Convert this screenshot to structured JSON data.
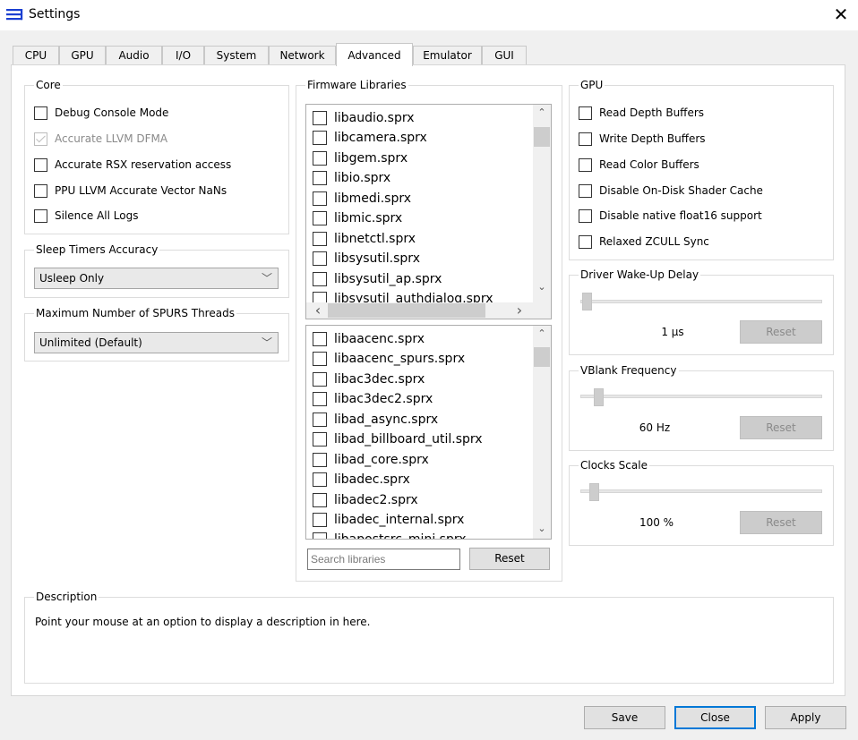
{
  "window": {
    "title": "Settings",
    "close_glyph": "✕"
  },
  "tabs": [
    {
      "label": "CPU"
    },
    {
      "label": "GPU"
    },
    {
      "label": "Audio"
    },
    {
      "label": "I/O"
    },
    {
      "label": "System"
    },
    {
      "label": "Network"
    },
    {
      "label": "Advanced"
    },
    {
      "label": "Emulator"
    },
    {
      "label": "GUI"
    }
  ],
  "active_tab": "Advanced",
  "core": {
    "title": "Core",
    "options": [
      {
        "label": "Debug Console Mode",
        "checked": false,
        "enabled": true
      },
      {
        "label": "Accurate LLVM DFMA",
        "checked": true,
        "enabled": false
      },
      {
        "label": "Accurate RSX reservation access",
        "checked": false,
        "enabled": true
      },
      {
        "label": "PPU LLVM Accurate Vector NaNs",
        "checked": false,
        "enabled": true
      },
      {
        "label": "Silence All Logs",
        "checked": false,
        "enabled": true
      }
    ]
  },
  "sleep_timers": {
    "title": "Sleep Timers Accuracy",
    "value": "Usleep Only"
  },
  "spurs": {
    "title": "Maximum Number of SPURS Threads",
    "value": "Unlimited (Default)"
  },
  "firmware": {
    "title": "Firmware Libraries",
    "list1": [
      "libaudio.sprx",
      "libcamera.sprx",
      "libgem.sprx",
      "libio.sprx",
      "libmedi.sprx",
      "libmic.sprx",
      "libnetctl.sprx",
      "libsysutil.sprx",
      "libsysutil_ap.sprx",
      "libsysutil_authdialog.sprx"
    ],
    "list2": [
      "libaacenc.sprx",
      "libaacenc_spurs.sprx",
      "libac3dec.sprx",
      "libac3dec2.sprx",
      "libad_async.sprx",
      "libad_billboard_util.sprx",
      "libad_core.sprx",
      "libadec.sprx",
      "libadec2.sprx",
      "libadec_internal.sprx",
      "libapostsrc_mini.sprx"
    ],
    "search_placeholder": "Search libraries",
    "reset_label": "Reset"
  },
  "gpu": {
    "title": "GPU",
    "options": [
      {
        "label": "Read Depth Buffers",
        "checked": false
      },
      {
        "label": "Write Depth Buffers",
        "checked": false
      },
      {
        "label": "Read Color Buffers",
        "checked": false
      },
      {
        "label": "Disable On-Disk Shader Cache",
        "checked": false
      },
      {
        "label": "Disable native float16 support",
        "checked": false
      },
      {
        "label": "Relaxed ZCULL Sync",
        "checked": false
      }
    ]
  },
  "driver_wakeup": {
    "title": "Driver Wake-Up Delay",
    "value_text": "1 µs",
    "level": 0.0,
    "reset_label": "Reset"
  },
  "vblank": {
    "title": "VBlank Frequency",
    "value_text": "60 Hz",
    "level": 0.05,
    "reset_label": "Reset"
  },
  "clocks": {
    "title": "Clocks Scale",
    "value_text": "100 %",
    "level": 0.03,
    "reset_label": "Reset"
  },
  "description": {
    "title": "Description",
    "text": "Point your mouse at an option to display a description in here."
  },
  "buttons": {
    "save": "Save",
    "close": "Close",
    "apply": "Apply"
  },
  "icons": {
    "chevron_down": "﹀",
    "arrow_up": "⌃",
    "arrow_down": "⌄",
    "arrow_left": "‹",
    "arrow_right": "›"
  },
  "accent_color": "#0078d7"
}
